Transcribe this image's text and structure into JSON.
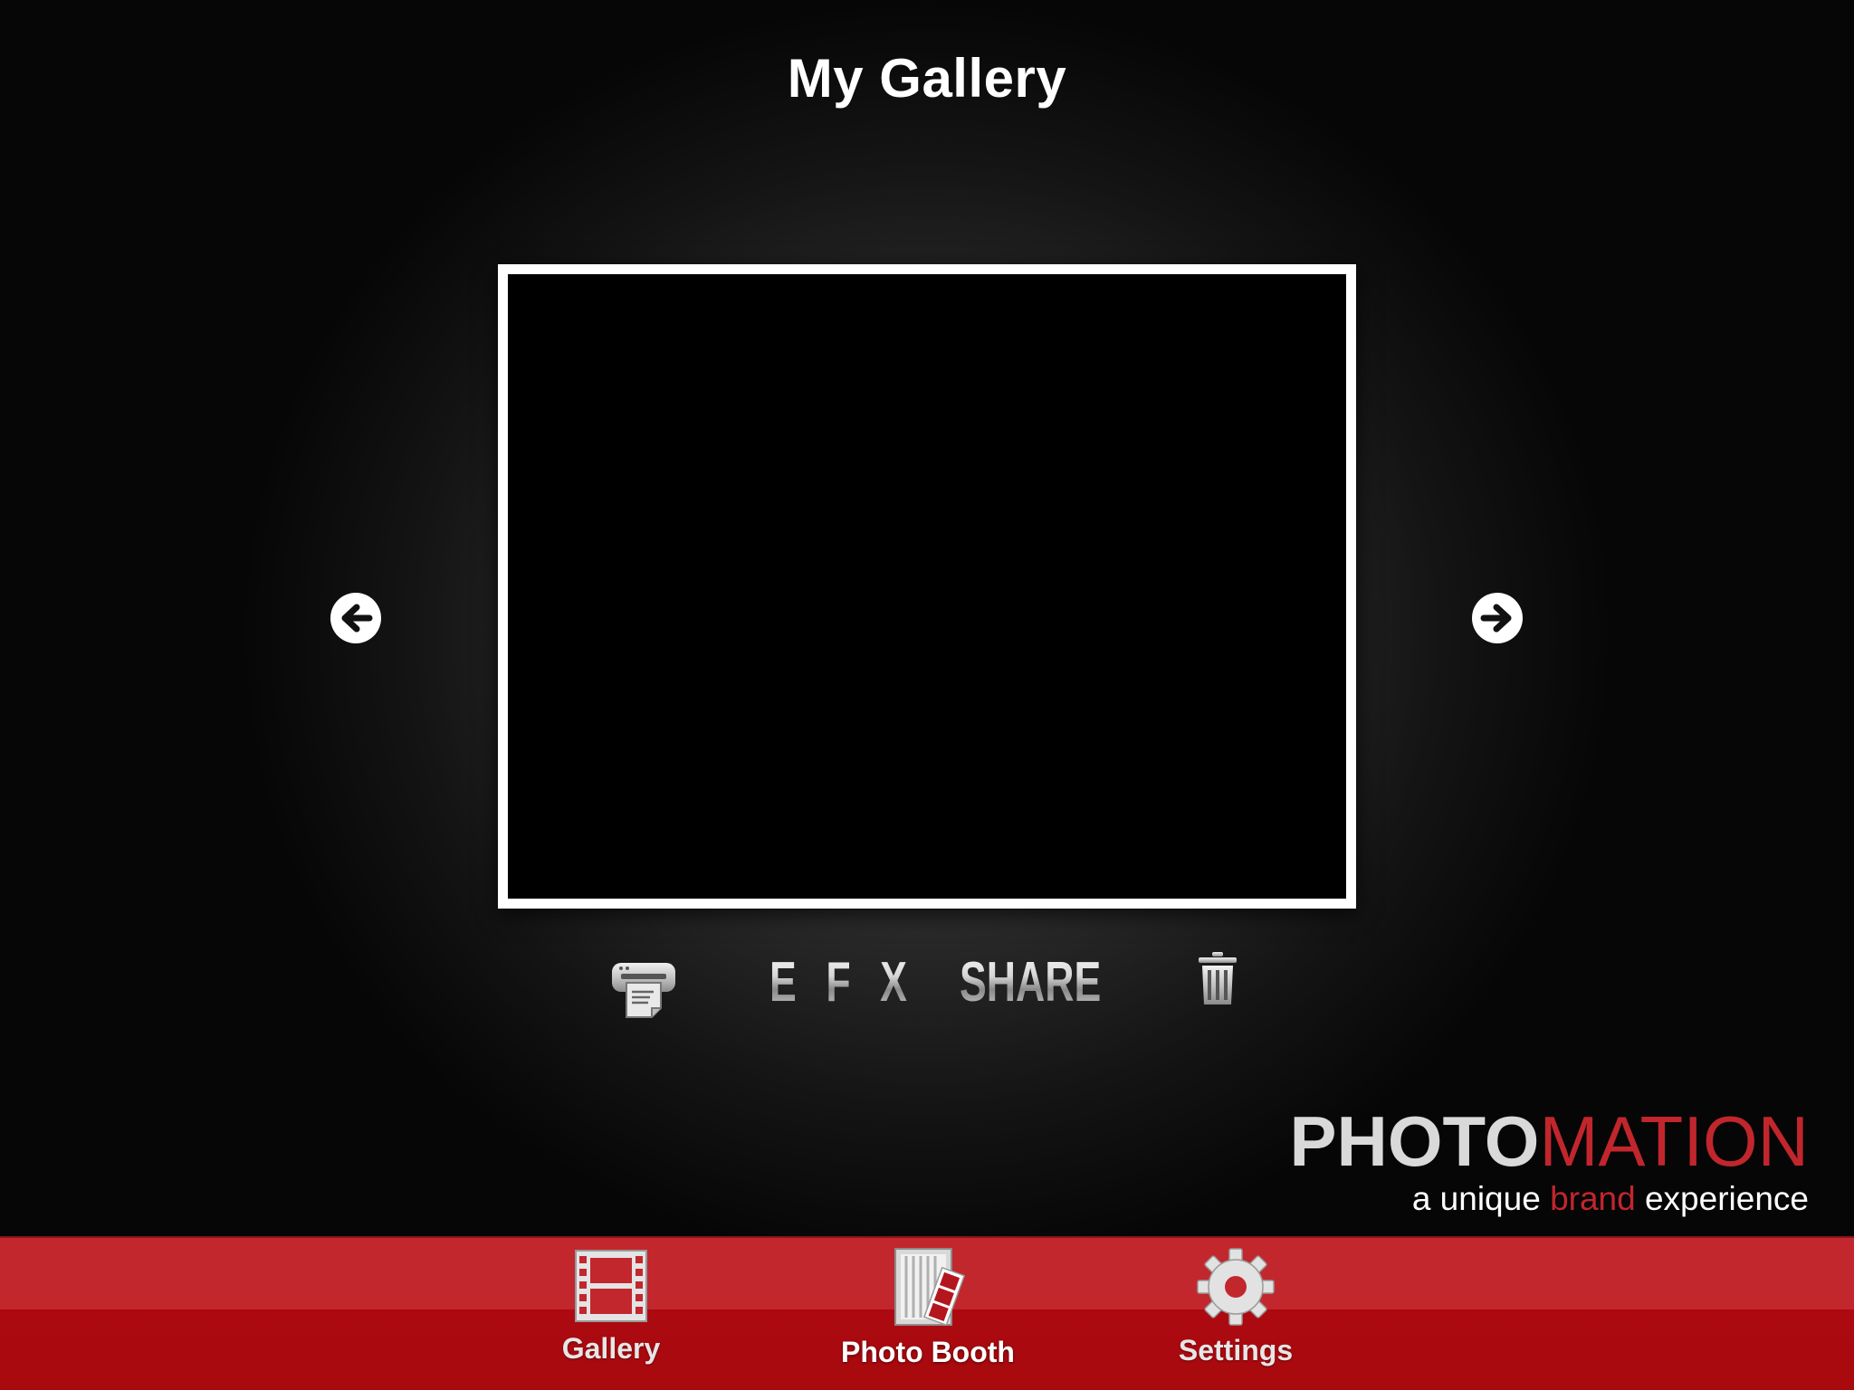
{
  "header": {
    "title": "My Gallery"
  },
  "gallery": {
    "prev_icon": "arrow-left-circle-icon",
    "next_icon": "arrow-right-circle-icon"
  },
  "actions": {
    "print_icon": "printer-icon",
    "efx_label": "E F X",
    "share_label": "SHARE",
    "delete_icon": "trash-icon"
  },
  "brand": {
    "name_part1": "PHOTO",
    "name_part2": "MATION",
    "tagline_before": "a unique ",
    "tagline_accent": "brand",
    "tagline_after": " experience",
    "accent_color": "#c1262d"
  },
  "tabbar": {
    "color": "#c2272d",
    "active_tab": "Photo Booth",
    "tabs": [
      {
        "label": "Gallery",
        "icon": "film-strip-icon"
      },
      {
        "label": "Photo Booth",
        "icon": "photo-booth-icon"
      },
      {
        "label": "Settings",
        "icon": "gear-icon"
      }
    ]
  }
}
